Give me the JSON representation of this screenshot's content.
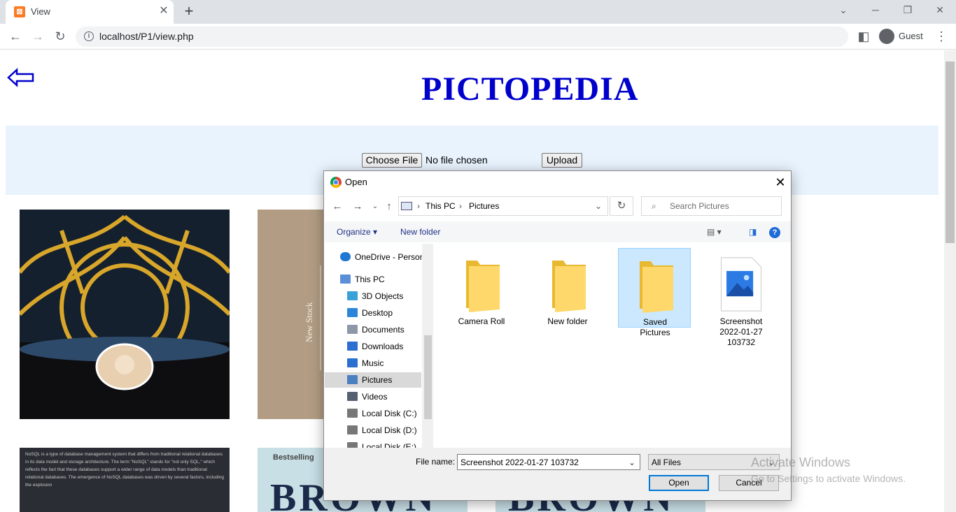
{
  "browser": {
    "tab_title": "View",
    "url": "localhost/P1/view.php",
    "profile_label": "Guest"
  },
  "page": {
    "heading": "PICTOPEDIA",
    "choose_file_label": "Choose File",
    "no_file_text": "No file chosen",
    "upload_label": "Upload",
    "nosql_text": "NoSQL is a type of database management system that differs from traditional relational databases in its data model and storage architecture. The term \"NoSQL\" stands for \"not only SQL,\" which reflects the fact that these databases support a wider range of data models than traditional relational databases. The emergence of NoSQL databases was driven by several factors, including the explosion",
    "book_small_text": "Bestselling",
    "book_big_text": "BROWN",
    "stock_text": "New Stock"
  },
  "dialog": {
    "title": "Open",
    "breadcrumb": [
      "This PC",
      "Pictures"
    ],
    "search_placeholder": "Search Pictures",
    "organize_label": "Organize",
    "new_folder_label": "New folder",
    "nav_items": [
      {
        "label": "OneDrive - Personal",
        "icon": "onedrive-icon"
      },
      {
        "label": "This PC",
        "icon": "computer-icon"
      },
      {
        "label": "3D Objects",
        "icon": "3d-objects-icon"
      },
      {
        "label": "Desktop",
        "icon": "desktop-icon"
      },
      {
        "label": "Documents",
        "icon": "documents-icon"
      },
      {
        "label": "Downloads",
        "icon": "downloads-icon"
      },
      {
        "label": "Music",
        "icon": "music-icon"
      },
      {
        "label": "Pictures",
        "icon": "pictures-icon",
        "selected": true
      },
      {
        "label": "Videos",
        "icon": "videos-icon"
      },
      {
        "label": "Local Disk (C:)",
        "icon": "drive-icon"
      },
      {
        "label": "Local Disk (D:)",
        "icon": "drive-icon"
      },
      {
        "label": "Local Disk (E:)",
        "icon": "drive-icon"
      }
    ],
    "files": [
      {
        "label": "Camera Roll",
        "type": "folder"
      },
      {
        "label": "New folder",
        "type": "folder"
      },
      {
        "label": "Saved Pictures",
        "type": "folder",
        "selected": true
      },
      {
        "label": "Screenshot 2022-01-27 103732",
        "type": "image"
      }
    ],
    "file_name_label": "File name:",
    "file_name_value": "Screenshot 2022-01-27 103732",
    "file_type_value": "All Files",
    "open_label": "Open",
    "cancel_label": "Cancel"
  },
  "watermark": {
    "line1": "Activate Windows",
    "line2": "Go to Settings to activate Windows."
  },
  "colors": {
    "heading": "#0000cd",
    "band": "#e8f3fd",
    "selection": "#cce8ff",
    "accent": "#0078d7"
  }
}
